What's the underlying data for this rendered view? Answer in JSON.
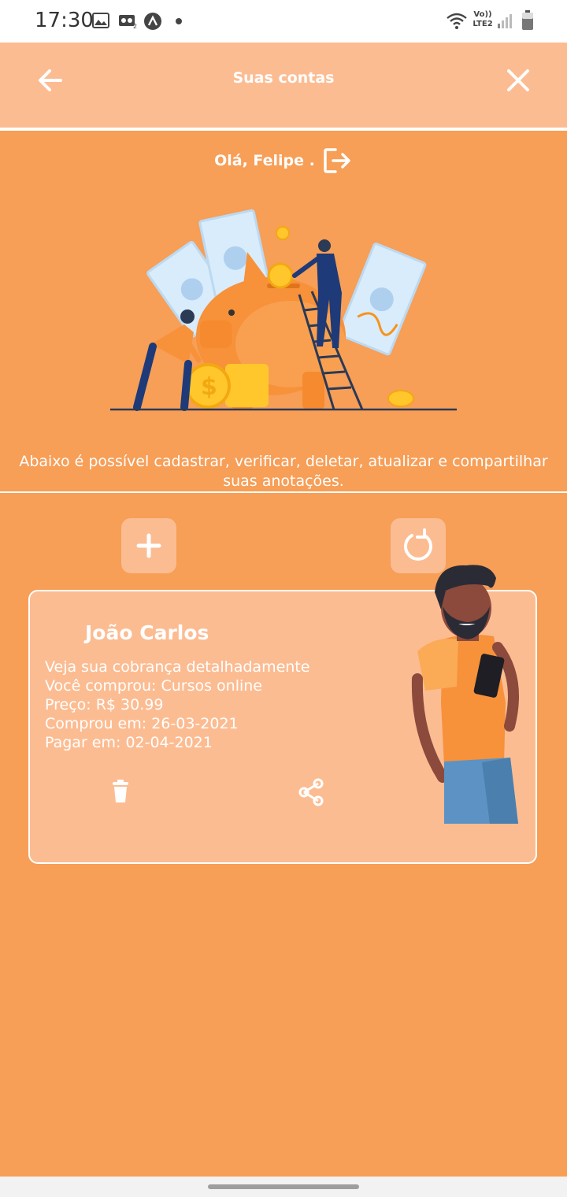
{
  "status_bar": {
    "time": "17:30",
    "network_label_top": "Vo))",
    "network_label_bottom": "LTE2",
    "icons": [
      "image-icon",
      "voicemail-icon",
      "a-badge-icon",
      "dot-icon",
      "wifi-icon",
      "signal-icon",
      "battery-icon"
    ]
  },
  "header": {
    "title": "Suas contas",
    "back_icon": "arrow-left-icon",
    "close_icon": "close-icon"
  },
  "greeting": {
    "text": "Olá, Felipe .",
    "logout_icon": "logout-icon"
  },
  "info_text": "Abaixo é possível cadastrar, verificar, deletar, atualizar e compartilhar suas anotações.",
  "actions": {
    "add_icon": "plus-icon",
    "refresh_icon": "refresh-icon"
  },
  "card": {
    "name": "João Carlos",
    "lines": [
      "Veja sua cobrança detalhadamente",
      "Você comprou: Cursos online",
      "Preço: R$ 30.99",
      "Comprou em: 26-03-2021",
      "Pagar em: 02-04-2021"
    ],
    "delete_icon": "trash-icon",
    "share_icon": "share-icon"
  },
  "colors": {
    "background": "#F79E57",
    "header": "#FCBC92",
    "card": "#FCBC92",
    "text": "#FFFFFF"
  }
}
